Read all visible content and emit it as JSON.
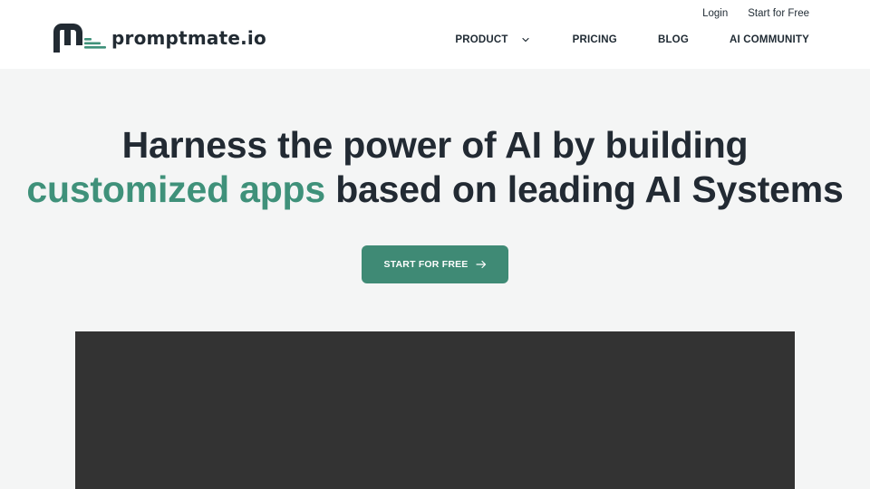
{
  "brand": {
    "name": "promptmate.io",
    "mark_color": "#222b33",
    "accent_color": "#3f917a"
  },
  "top_links": {
    "login": "Login",
    "start": "Start for Free"
  },
  "nav": {
    "product": "PRODUCT",
    "pricing": "PRICING",
    "blog": "BLOG",
    "community": "AI COMMUNITY"
  },
  "hero": {
    "line1": "Harness the power of AI by building",
    "accent": "customized apps",
    "line2_rest": " based on leading AI Systems",
    "cta_label": "START FOR FREE",
    "cta_color": "#3f8a75"
  },
  "icons": {
    "dropdown": "chevron-down-icon",
    "cta": "arrow-right-icon"
  }
}
